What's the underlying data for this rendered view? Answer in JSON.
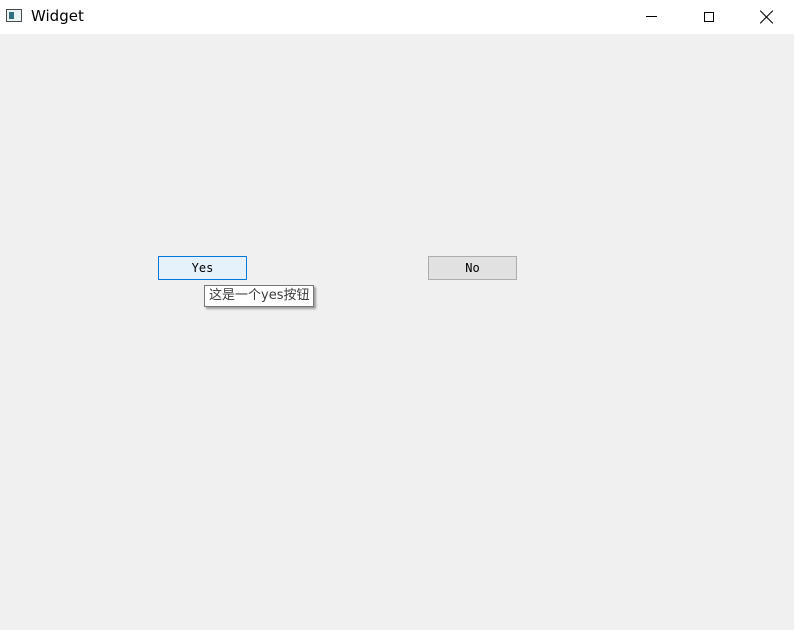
{
  "window": {
    "title": "Widget",
    "icon": "app-window-icon",
    "controls": [
      "minimize-icon",
      "maximize-icon",
      "close-icon"
    ]
  },
  "buttons": {
    "yes_label": "Yes",
    "no_label": "No"
  },
  "tooltip": {
    "text": "这是一个yes按钮"
  },
  "colors": {
    "background": "#f0f0f0",
    "focus_border": "#0078d7",
    "hover_fill": "#e5f1fb",
    "button_fill": "#e1e1e1"
  }
}
